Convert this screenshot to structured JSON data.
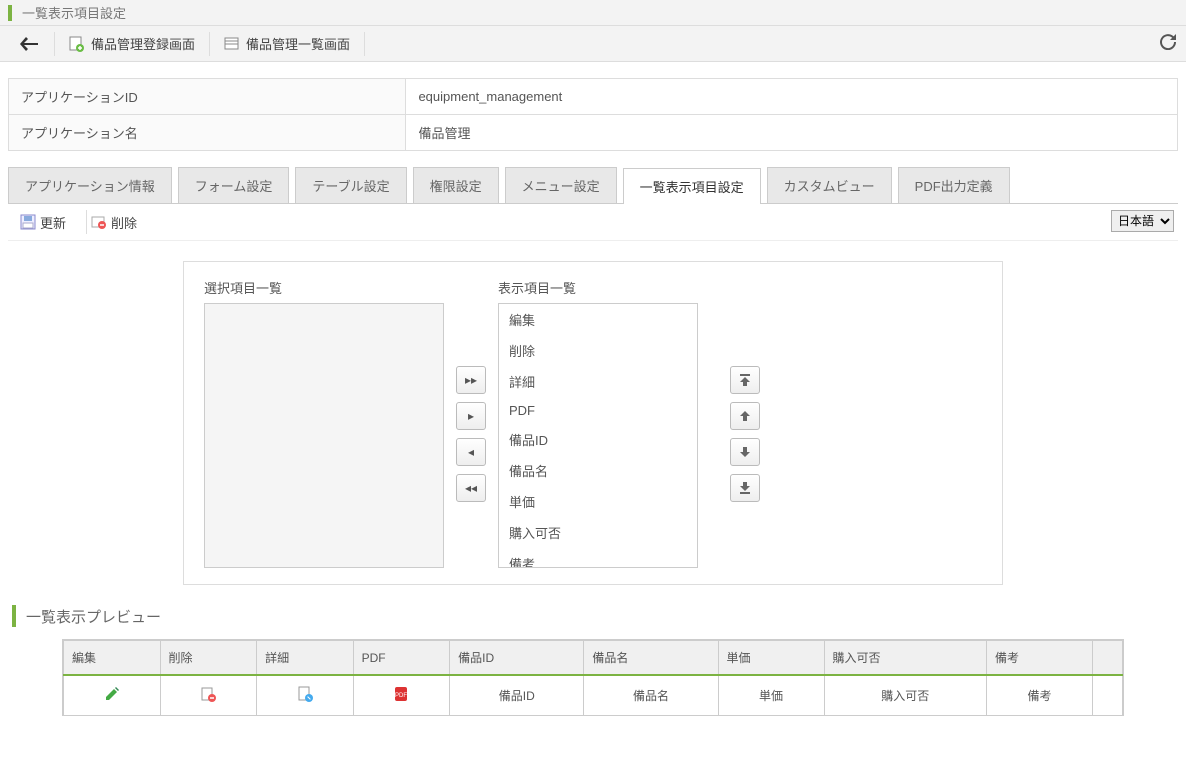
{
  "header": {
    "title": "一覧表示項目設定"
  },
  "toolbar": {
    "items": [
      {
        "label": "備品管理登録画面"
      },
      {
        "label": "備品管理一覧画面"
      }
    ]
  },
  "info": {
    "app_id_label": "アプリケーションID",
    "app_id_value": "equipment_management",
    "app_name_label": "アプリケーション名",
    "app_name_value": "備品管理"
  },
  "tabs": [
    "アプリケーション情報",
    "フォーム設定",
    "テーブル設定",
    "権限設定",
    "メニュー設定",
    "一覧表示項目設定",
    "カスタムビュー",
    "PDF出力定義"
  ],
  "active_tab_index": 5,
  "actions": {
    "update": "更新",
    "delete": "削除",
    "language": "日本語"
  },
  "panel": {
    "select_label": "選択項目一覧",
    "display_label": "表示項目一覧",
    "display_items": [
      "編集",
      "削除",
      "詳細",
      "PDF",
      "備品ID",
      "備品名",
      "単価",
      "購入可否",
      "備考"
    ]
  },
  "preview": {
    "title": "一覧表示プレビュー",
    "headers": [
      "編集",
      "削除",
      "詳細",
      "PDF",
      "備品ID",
      "備品名",
      "単価",
      "購入可否",
      "備考"
    ],
    "row": [
      "",
      "",
      "",
      "",
      "備品ID",
      "備品名",
      "単価",
      "購入可否",
      "備考"
    ]
  }
}
